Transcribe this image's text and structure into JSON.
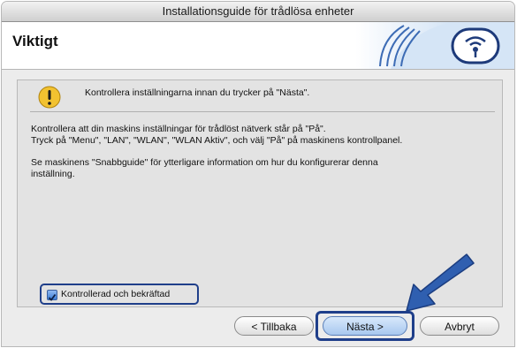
{
  "window": {
    "title": "Installationsguide för trådlösa enheter"
  },
  "header": {
    "title": "Viktigt",
    "logo_icon": "wireless-signal-icon"
  },
  "notice": {
    "icon": "warning-icon",
    "text": "Kontrollera inställningarna innan du trycker på \"Nästa\"."
  },
  "body": {
    "line1": "Kontrollera att din maskins inställningar för trådlöst nätverk står på \"På\".",
    "line2": "Tryck på \"Menu\", \"LAN\", \"WLAN\", \"WLAN Aktiv\", och välj \"På\" på maskinens kontrollpanel.",
    "line3": "Se maskinens \"Snabbguide\" för ytterligare information om hur du konfigurerar denna",
    "line4": "inställning."
  },
  "confirm": {
    "label": "Kontrollerad och bekräftad",
    "checked": true
  },
  "buttons": {
    "back": "< Tillbaka",
    "next": "Nästa >",
    "cancel": "Avbryt"
  },
  "colors": {
    "highlight": "#1f3f8a",
    "arrow": "#2f5fb0",
    "warning": "#f2c230"
  }
}
